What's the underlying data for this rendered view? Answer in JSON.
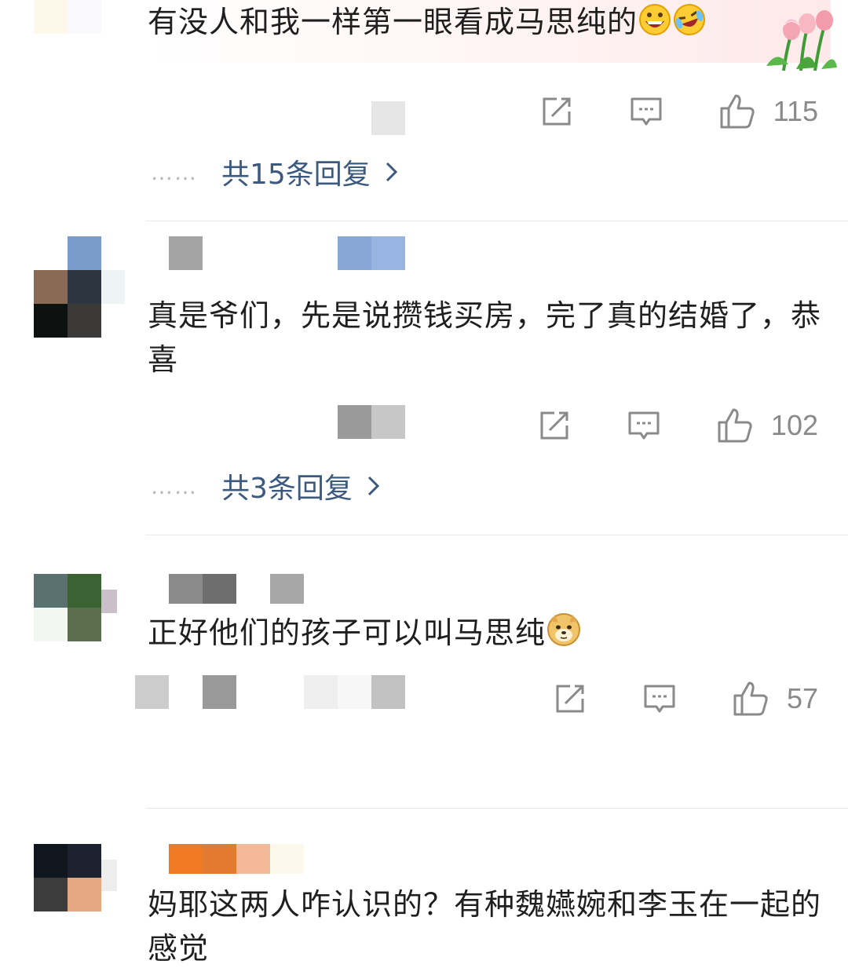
{
  "comments": [
    {
      "text": "有没人和我一样第一眼看成马思纯的",
      "emojis": [
        "grinning-face-icon",
        "laughing-tears-icon"
      ],
      "likes": "115",
      "replies_label": "共15条回复"
    },
    {
      "text": "真是爷们，先是说攒钱买房，完了真的结婚了，恭喜",
      "likes": "102",
      "replies_label": "共3条回复"
    },
    {
      "text": "正好他们的孩子可以叫马思纯",
      "emojis": [
        "doge-icon"
      ],
      "likes": "57"
    },
    {
      "text": "妈耶这两人咋认识的？有种魏嬿婉和李玉在一起的感觉"
    }
  ],
  "replies_prefix": "……",
  "colors": {
    "link": "#3c5a7d",
    "icon": "#8a8a8a",
    "divider": "#e7e7e7",
    "text": "#1f1f1f"
  }
}
